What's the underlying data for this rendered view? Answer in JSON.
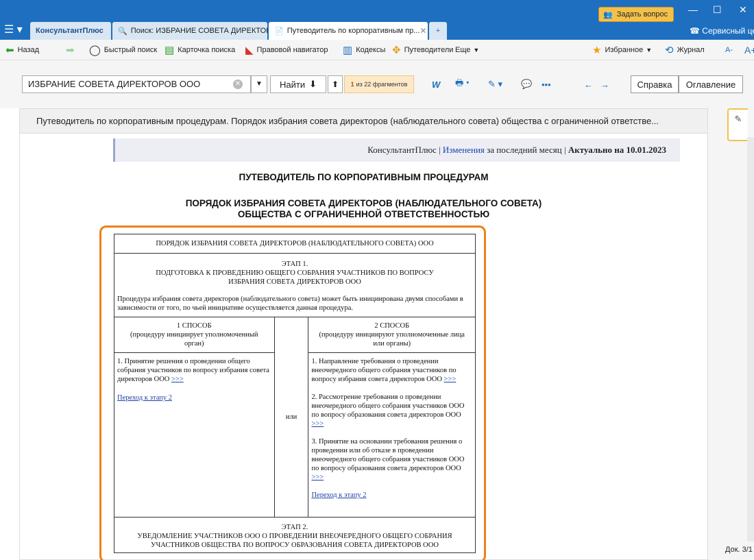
{
  "tabs": [
    {
      "label": "КонсультантПлюс"
    },
    {
      "label": "Поиск: ИЗБРАНИЕ СОВЕТА ДИРЕКТОР..."
    },
    {
      "label": "Путеводитель по корпоративным пр..."
    },
    {
      "label": "+"
    }
  ],
  "ask_button": "Задать вопрос",
  "service_center": "Сервисный цен",
  "toolbar": {
    "back": "Назад",
    "quick_search": "Быстрый поиск",
    "search_card": "Карточка поиска",
    "legal_navigator": "Правовой навигатор",
    "codes": "Кодексы",
    "guides": "Путеводители",
    "more": "Еще",
    "favorites": "Избранное",
    "journal": "Журнал",
    "font_small": "A-",
    "font_big": "A+"
  },
  "search": {
    "value": "ИЗБРАНИЕ СОВЕТА ДИРЕКТОРОВ ООО",
    "find_label": "Найти",
    "fragments_bold": "1",
    "fragments_rest": "из 22 фрагментов",
    "help": "Справка",
    "contents": "Оглавление"
  },
  "doc": {
    "header": "Путеводитель по корпоративным процедурам. Порядок избрания совета директоров (наблюдательного совета) общества с ограниченной ответстве...",
    "actual_prefix": "КонсультантПлюс |",
    "actual_link": "Изменения",
    "actual_middle": "за последний месяц |",
    "actual_bold": "Актуально на 10.01.2023",
    "title1": "ПУТЕВОДИТЕЛЬ ПО КОРПОРАТИВНЫМ ПРОЦЕДУРАМ",
    "title2": "ПОРЯДОК ИЗБРАНИЯ СОВЕТА ДИРЕКТОРОВ (НАБЛЮДАТЕЛЬНОГО СОВЕТА)",
    "title3": "ОБЩЕСТВА С ОГРАНИЧЕННОЙ ОТВЕТСТВЕННОСТЬЮ",
    "position": "Док. 3/1"
  },
  "table": {
    "header": "ПОРЯДОК ИЗБРАНИЯ СОВЕТА ДИРЕКТОРОВ (НАБЛЮДАТЕЛЬНОГО СОВЕТА) ООО",
    "stage1_title": "ЭТАП 1.",
    "stage1_text": "ПОДГОТОВКА К ПРОВЕДЕНИЮ ОБЩЕГО СОБРАНИЯ УЧАСТНИКОВ ПО ВОПРОСУ ИЗБРАНИЯ СОВЕТА ДИРЕКТОРОВ ООО",
    "intro": "Процедура избрания совета директоров (наблюдательного совета) может быть инициирована двумя способами в зависимости от того, по чьей инициативе осуществляется данная процедура.",
    "way1_title": "1 СПОСОБ",
    "way1_sub": "(процедуру инициирует уполномоченный орган)",
    "way2_title": "2 СПОСОБ",
    "way2_sub": "(процедуру инициируют уполномоченные лица или органы)",
    "or": "или",
    "left_item1": "1. Принятие решения о проведении общего собрания участников по вопросу избрания совета директоров ООО",
    "arrow": ">>>",
    "left_link": "Переход к этапу 2",
    "right_item1": "1. Направление требования о проведении внеочередного общего собрания участников по вопросу избрания совета директоров ООО",
    "right_item2": "2. Рассмотрение требования о проведении внеочередного общего собрания участников ООО по вопросу образования совета директоров ООО",
    "right_item3": "3. Принятие на основании требования решения о проведении или об отказе в проведении внеочередного общего собрания участников ООО по вопросу образования совета директоров ООО",
    "right_link": "Переход к этапу 2",
    "stage2_title": "ЭТАП 2.",
    "stage2_text": "УВЕДОМЛЕНИЕ УЧАСТНИКОВ ООО О ПРОВЕДЕНИИ ВНЕОЧЕРЕДНОГО ОБЩЕГО СОБРАНИЯ УЧАСТНИКОВ ОБЩЕСТВА ПО ВОПРОСУ ОБРАЗОВАНИЯ СОВЕТА ДИРЕКТОРОВ ООО"
  },
  "colors": {
    "brand": "#1e6fbf",
    "highlight": "#ef7f1a",
    "link": "#1b3fa6"
  }
}
